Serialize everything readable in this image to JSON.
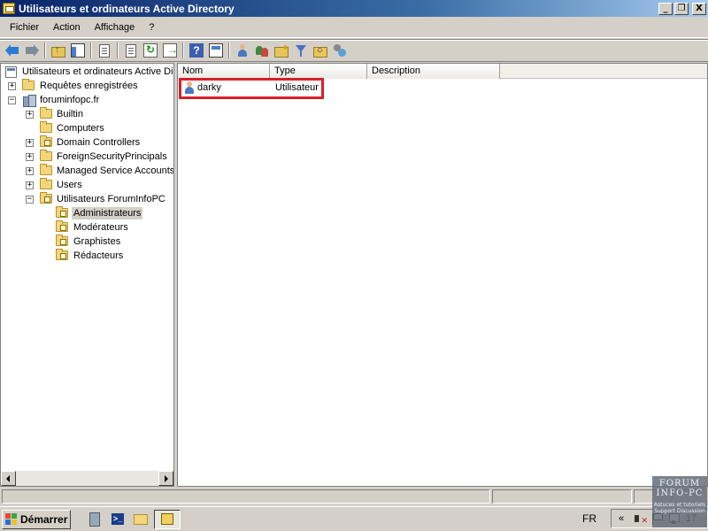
{
  "window": {
    "title": "Utilisateurs et ordinateurs Active Directory",
    "minimize": "_",
    "restore": "❐",
    "close": "X"
  },
  "menu": [
    "Fichier",
    "Action",
    "Affichage",
    "?"
  ],
  "toolbar_icons": [
    "back-arrow-icon",
    "forward-arrow-icon",
    "up-level-icon",
    "show-hide-tree-icon",
    "copy-icon",
    "properties-icon",
    "refresh-icon",
    "export-list-icon",
    "help-icon",
    "mmc-view-icon",
    "new-user-icon",
    "new-group-icon",
    "new-ou-icon",
    "filter-icon",
    "find-icon",
    "add-to-group-icon"
  ],
  "tree": {
    "root": "Utilisateurs et ordinateurs Active Di",
    "saved_queries": "Requêtes enregistrées",
    "domain": "foruminfopc.fr",
    "containers": [
      "Builtin",
      "Computers",
      "Domain Controllers",
      "ForeignSecurityPrincipals",
      "Managed Service Accounts",
      "Users",
      "Utilisateurs ForumInfoPC"
    ],
    "sub_ous": [
      "Administrateurs",
      "Modérateurs",
      "Graphistes",
      "Rédacteurs"
    ],
    "selected": "Administrateurs"
  },
  "list": {
    "columns": [
      "Nom",
      "Type",
      "Description"
    ],
    "rows": [
      {
        "nom": "darky",
        "type": "Utilisateur",
        "description": ""
      }
    ],
    "highlight_color": "#d8202a"
  },
  "taskbar": {
    "start_label": "Démarrer",
    "language": "FR",
    "clock": "17"
  },
  "watermark": {
    "line1": "FORUM",
    "line2": "INFO-PC",
    "sub": "Astuces et tutoriels Support Discussion"
  }
}
